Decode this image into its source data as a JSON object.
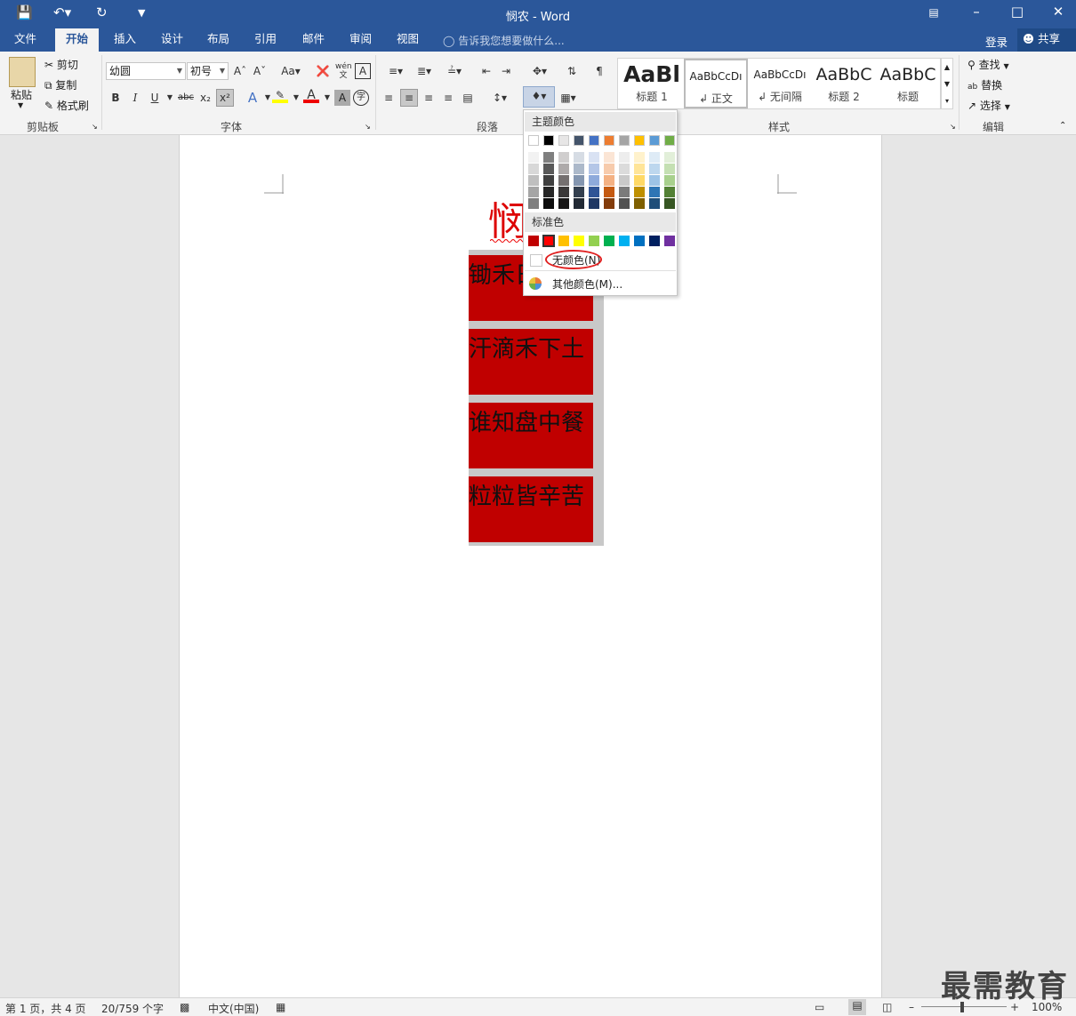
{
  "titlebar": {
    "doc_title": "悯农 - Word"
  },
  "tabs": [
    "文件",
    "开始",
    "插入",
    "设计",
    "布局",
    "引用",
    "邮件",
    "审阅",
    "视图"
  ],
  "tell_me": "告诉我您想要做什么...",
  "sign_in": "登录",
  "share": "共享",
  "clipboard": {
    "paste": "粘贴",
    "cut": "剪切",
    "copy": "复制",
    "format_painter": "格式刷",
    "group": "剪贴板"
  },
  "font": {
    "name": "幼圆",
    "size": "初号",
    "group": "字体"
  },
  "paragraph": {
    "group": "段落"
  },
  "styles": {
    "group": "样式",
    "items": [
      {
        "preview": "AaBl",
        "name": "标题 1"
      },
      {
        "preview": "AaBbCcDı",
        "name": "↲ 正文"
      },
      {
        "preview": "AaBbCcDı",
        "name": "↲ 无间隔"
      },
      {
        "preview": "AaBbC",
        "name": "标题 2"
      },
      {
        "preview": "AaBbC",
        "name": "标题"
      }
    ]
  },
  "editing": {
    "find": "查找",
    "replace": "替换",
    "select": "选择",
    "group": "编辑"
  },
  "document": {
    "title_char": "悯",
    "lines": [
      "锄禾日当午",
      "汗滴禾下土",
      "谁知盘中餐",
      "粒粒皆辛苦"
    ]
  },
  "shading_menu": {
    "theme_header": "主题颜色",
    "standard_header": "标准色",
    "no_color": "无颜色(N)",
    "more_colors": "其他颜色(M)...",
    "theme_top": [
      "#ffffff",
      "#000000",
      "#e7e6e6",
      "#44546a",
      "#4472c4",
      "#ed7d31",
      "#a5a5a5",
      "#ffc000",
      "#5b9bd5",
      "#70ad47"
    ],
    "theme_shades": [
      [
        "#f2f2f2",
        "#d8d8d8",
        "#bfbfbf",
        "#a5a5a5",
        "#7f7f7f"
      ],
      [
        "#7f7f7f",
        "#595959",
        "#3f3f3f",
        "#262626",
        "#0d0d0d"
      ],
      [
        "#d0cece",
        "#aeaaaa",
        "#757070",
        "#3a3838",
        "#171616"
      ],
      [
        "#d6dce4",
        "#acb9ca",
        "#8496b0",
        "#333f4f",
        "#222a35"
      ],
      [
        "#d9e2f3",
        "#b4c6e7",
        "#8eaadb",
        "#2f5496",
        "#1f3864"
      ],
      [
        "#fbe5d5",
        "#f7cbac",
        "#f4b183",
        "#c55a11",
        "#833c0b"
      ],
      [
        "#ededed",
        "#dbdbdb",
        "#c9c9c9",
        "#7b7b7b",
        "#525252"
      ],
      [
        "#fff2cc",
        "#ffe599",
        "#ffd966",
        "#bf9000",
        "#7f6000"
      ],
      [
        "#deebf6",
        "#bdd7ee",
        "#9dc3e6",
        "#2e75b5",
        "#1f4e79"
      ],
      [
        "#e2efd9",
        "#c5e0b3",
        "#a8d08d",
        "#538135",
        "#375623"
      ]
    ],
    "standard": [
      "#c00000",
      "#ff0000",
      "#ffc000",
      "#ffff00",
      "#92d050",
      "#00b050",
      "#00b0f0",
      "#0070c0",
      "#002060",
      "#7030a0"
    ]
  },
  "status": {
    "page": "第 1 页，共 4 页",
    "words": "20/759 个字",
    "language": "中文(中国)",
    "zoom": "100%"
  },
  "watermark": "最需教育",
  "colors": {
    "accent": "#2b579a",
    "shading": "#c00000",
    "title_red": "#dd0000"
  }
}
